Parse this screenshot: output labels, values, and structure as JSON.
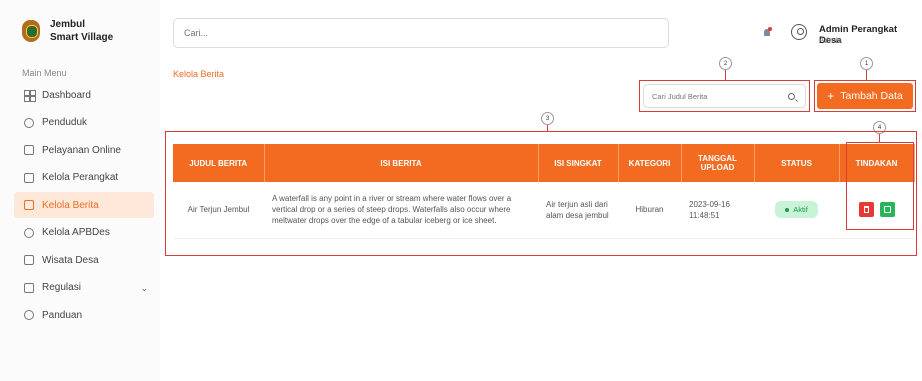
{
  "brand": {
    "line1": "Jembul",
    "line2": "Smart Village"
  },
  "sidebar": {
    "menu_title": "Main Menu",
    "items": [
      {
        "label": "Dashboard",
        "icon": "grid-icon"
      },
      {
        "label": "Penduduk",
        "icon": "users-icon"
      },
      {
        "label": "Pelayanan Online",
        "icon": "service-icon"
      },
      {
        "label": "Kelola Perangkat",
        "icon": "device-icon"
      },
      {
        "label": "Kelola Berita",
        "icon": "news-icon",
        "active": true
      },
      {
        "label": "Kelola APBDes",
        "icon": "budget-icon"
      },
      {
        "label": "Wisata Desa",
        "icon": "tour-icon"
      },
      {
        "label": "Regulasi",
        "icon": "regulation-icon",
        "has_chevron": true
      },
      {
        "label": "Panduan",
        "icon": "guide-icon"
      }
    ]
  },
  "topbar": {
    "search_placeholder": "Cari...",
    "user_name": "Admin Perangkat Desa",
    "user_role": "Admin"
  },
  "breadcrumb": "Kelola Berita",
  "search_berita_placeholder": "Cari Judul Berita",
  "add_button": {
    "plus": "+",
    "label": "Tambah Data"
  },
  "callouts": [
    "1",
    "2",
    "3",
    "4"
  ],
  "table": {
    "headers": [
      "JUDUL BERITA",
      "ISI BERITA",
      "ISI SINGKAT",
      "KATEGORI",
      "TANGGAL UPLOAD",
      "STATUS",
      "TINDAKAN"
    ],
    "rows": [
      {
        "judul": "Air Terjun Jembul",
        "isi": "A waterfall is any point in a river or stream where water flows over a vertical drop or a series of steep drops. Waterfalls also occur where meltwater drops over the edge of a tabular iceberg or ice sheet.",
        "singkat": "Air terjun asli dari alam desa jembul",
        "kategori": "Hiburan",
        "tanggal": "2023-09-16 11:48:51",
        "status": "Aktif"
      }
    ]
  },
  "colors": {
    "accent": "#f26b21",
    "annotation": "#dc3b3b",
    "status_bg": "#c8f3d6",
    "delete": "#e53935",
    "edit": "#29b45a"
  }
}
